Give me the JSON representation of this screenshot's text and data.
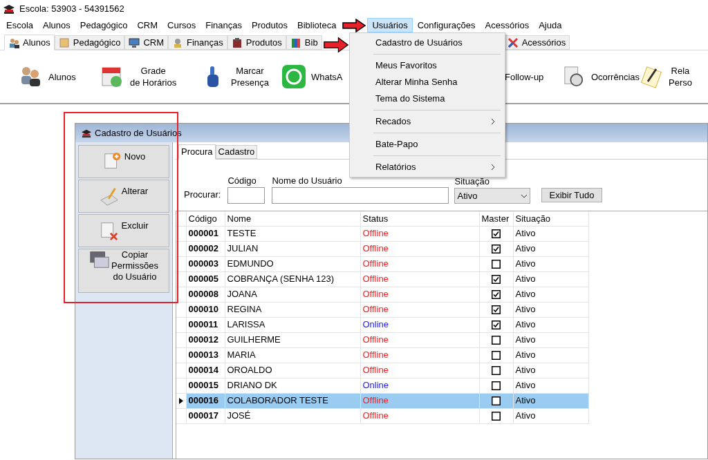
{
  "window": {
    "title": "Escola: 53903 - 54391562"
  },
  "menu_bar": [
    {
      "label": "Escola",
      "selected": false
    },
    {
      "label": "Alunos",
      "selected": false
    },
    {
      "label": "Pedagógico",
      "selected": false
    },
    {
      "label": "CRM",
      "selected": false
    },
    {
      "label": "Cursos",
      "selected": false
    },
    {
      "label": "Finanças",
      "selected": false
    },
    {
      "label": "Produtos",
      "selected": false
    },
    {
      "label": "Biblioteca",
      "selected": false
    },
    {
      "label": "Usuários",
      "selected": true
    },
    {
      "label": "Configurações",
      "selected": false
    },
    {
      "label": "Acessórios",
      "selected": false
    },
    {
      "label": "Ajuda",
      "selected": false
    }
  ],
  "open_menu": {
    "groups": [
      [
        {
          "label": "Cadastro de Usuários",
          "submenu": false
        }
      ],
      [
        {
          "label": "Meus Favoritos",
          "submenu": false
        },
        {
          "label": "Alterar Minha Senha",
          "submenu": false
        },
        {
          "label": "Tema do Sistema",
          "submenu": false
        }
      ],
      [
        {
          "label": "Recados",
          "submenu": true
        }
      ],
      [
        {
          "label": "Bate-Papo",
          "submenu": false
        }
      ],
      [
        {
          "label": "Relatórios",
          "submenu": true
        }
      ]
    ]
  },
  "module_tabs": [
    {
      "label": "Alunos",
      "selected": true
    },
    {
      "label": "Pedagógico",
      "selected": false
    },
    {
      "label": "CRM",
      "selected": false
    },
    {
      "label": "Finanças",
      "selected": false
    },
    {
      "label": "Produtos",
      "selected": false
    },
    {
      "label": "Bib",
      "selected": false
    },
    {
      "label": "Acessórios",
      "selected": false
    }
  ],
  "toolbar": [
    {
      "lines": [
        "Alunos"
      ]
    },
    {
      "lines": [
        "Grade",
        "de Horários"
      ]
    },
    {
      "lines": [
        "Marcar",
        "Presença"
      ]
    },
    {
      "lines": [
        "WhatsA"
      ]
    },
    {
      "lines": [
        "Follow-up"
      ]
    },
    {
      "lines": [
        "Ocorrências"
      ]
    },
    {
      "lines": [
        "Rela",
        "Perso"
      ]
    }
  ],
  "child_window": {
    "title": "Cadastro de Usuários",
    "side_buttons": [
      {
        "lines": [
          "Novo"
        ]
      },
      {
        "lines": [
          "Alterar"
        ]
      },
      {
        "lines": [
          "Excluir"
        ]
      },
      {
        "lines": [
          "Copiar",
          "Permissões",
          "do Usuário"
        ]
      }
    ],
    "tabs": [
      {
        "label": "Procura",
        "selected": true
      },
      {
        "label": "Cadastro",
        "selected": false
      }
    ],
    "search": {
      "label": "Procurar:",
      "code_label": "Código",
      "name_label": "Nome do Usuário",
      "status_label": "Situação",
      "status_value": "Ativo",
      "show_all_button": "Exibir Tudo"
    },
    "table": {
      "columns": [
        "Código",
        "Nome",
        "Status",
        "Master",
        "Situação"
      ],
      "rows": [
        {
          "code": "000001",
          "name": "TESTE",
          "status": "Offline",
          "online": false,
          "master": true,
          "situation": "Ativo",
          "selected": false
        },
        {
          "code": "000002",
          "name": "JULIAN",
          "status": "Offline",
          "online": false,
          "master": true,
          "situation": "Ativo",
          "selected": false
        },
        {
          "code": "000003",
          "name": "EDMUNDO",
          "status": "Offline",
          "online": false,
          "master": false,
          "situation": "Ativo",
          "selected": false
        },
        {
          "code": "000005",
          "name": "COBRANÇA (SENHA 123)",
          "status": "Offline",
          "online": false,
          "master": true,
          "situation": "Ativo",
          "selected": false
        },
        {
          "code": "000008",
          "name": "JOANA",
          "status": "Offline",
          "online": false,
          "master": true,
          "situation": "Ativo",
          "selected": false
        },
        {
          "code": "000010",
          "name": "REGINA",
          "status": "Offline",
          "online": false,
          "master": true,
          "situation": "Ativo",
          "selected": false
        },
        {
          "code": "000011",
          "name": "LARISSA",
          "status": "Online",
          "online": true,
          "master": true,
          "situation": "Ativo",
          "selected": false
        },
        {
          "code": "000012",
          "name": "GUILHERME",
          "status": "Offline",
          "online": false,
          "master": false,
          "situation": "Ativo",
          "selected": false
        },
        {
          "code": "000013",
          "name": "MARIA",
          "status": "Offline",
          "online": false,
          "master": false,
          "situation": "Ativo",
          "selected": false
        },
        {
          "code": "000014",
          "name": "OROALDO",
          "status": "Offline",
          "online": false,
          "master": false,
          "situation": "Ativo",
          "selected": false
        },
        {
          "code": "000015",
          "name": "DRIANO DK",
          "status": "Online",
          "online": true,
          "master": false,
          "situation": "Ativo",
          "selected": false
        },
        {
          "code": "000016",
          "name": "COLABORADOR TESTE",
          "status": "Offline",
          "online": false,
          "master": false,
          "situation": "Ativo",
          "selected": true
        },
        {
          "code": "000017",
          "name": "JOSÉ",
          "status": "Offline",
          "online": false,
          "master": false,
          "situation": "Ativo",
          "selected": false
        }
      ]
    }
  }
}
